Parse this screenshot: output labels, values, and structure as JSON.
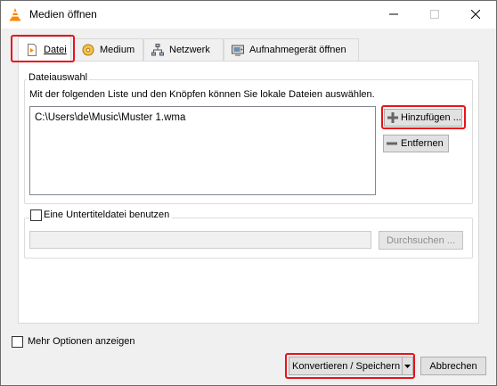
{
  "window": {
    "title": "Medien öffnen"
  },
  "tabs": [
    {
      "label": "Datei",
      "icon": "file-icon",
      "active": true
    },
    {
      "label": "Medium",
      "icon": "disc-icon",
      "active": false
    },
    {
      "label": "Netzwerk",
      "icon": "network-icon",
      "active": false
    },
    {
      "label": "Aufnahmegerät öffnen",
      "icon": "capture-device-icon",
      "active": false
    }
  ],
  "file_selection": {
    "group_title": "Dateiauswahl",
    "description": "Mit der folgenden Liste und den Knöpfen können Sie lokale Dateien auswählen.",
    "files": [
      "C:\\Users\\de\\Music\\Muster 1.wma"
    ],
    "add_label": "Hinzufügen ...",
    "remove_label": "Entfernen"
  },
  "subtitle": {
    "checkbox_label": "Eine Untertiteldatei benutzen",
    "checked": false,
    "browse_label": "Durchsuchen ..."
  },
  "footer": {
    "more_options_label": "Mehr Optionen anzeigen",
    "more_options_checked": false,
    "convert_label": "Konvertieren / Speichern",
    "cancel_label": "Abbrechen"
  },
  "colors": {
    "highlight": "#e8131b",
    "vlc_orange": "#ff8800"
  }
}
